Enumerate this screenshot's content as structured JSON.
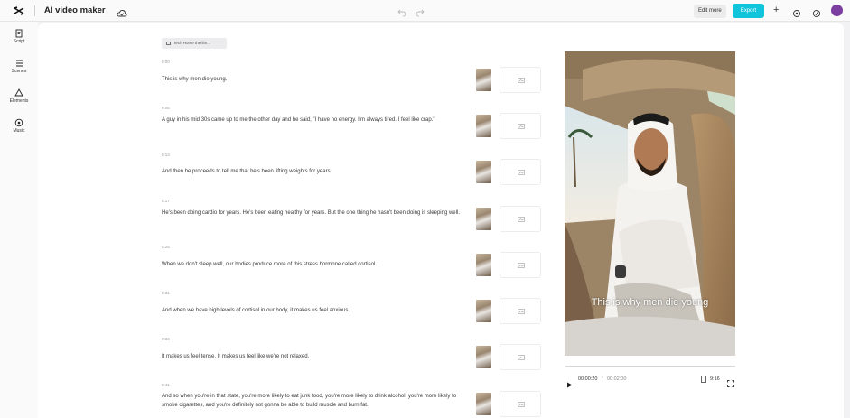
{
  "header": {
    "app_title": "AI video maker",
    "edit_more_label": "Edit more",
    "export_label": "Export",
    "add_label": "+"
  },
  "sidebar": {
    "items": [
      {
        "label": "Script",
        "icon": "script-icon"
      },
      {
        "label": "Scenes",
        "icon": "scenes-icon"
      },
      {
        "label": "Elements",
        "icon": "elements-icon"
      },
      {
        "label": "Music",
        "icon": "music-icon"
      }
    ]
  },
  "script": {
    "chip_label": "Tech Home the lim...",
    "scenes": [
      {
        "time": "0:00",
        "text": "This is why men die young."
      },
      {
        "time": "0:05",
        "text": "A guy in his mid 30s came up to me the other day and he said, \"I have no energy. I'm always tired. I feel like crap.\""
      },
      {
        "time": "0:13",
        "text": "And then he proceeds to tell me that he's been lifting weights for years."
      },
      {
        "time": "0:17",
        "text": "He's been doing cardio for years. He's been eating healthy for years. But the one thing he hasn't been doing is sleeping well."
      },
      {
        "time": "0:25",
        "text": "When we don't sleep well, our bodies produce more of this stress hormone called cortisol."
      },
      {
        "time": "0:31",
        "text": "And when we have high levels of cortisol in our body, it makes us feel anxious."
      },
      {
        "time": "0:34",
        "text": "It makes us feel tense. It makes us feel like we're not relaxed."
      },
      {
        "time": "0:41",
        "text": "And so when you're in that state, you're more likely to eat junk food, you're more likely to drink alcohol, you're more likely to smoke cigarettes, and you're definitely not gonna be able to build muscle and burn fat."
      }
    ]
  },
  "preview": {
    "caption": "This is why men die young",
    "progress": 0.0,
    "current_time": "00:00:20",
    "separator": "/",
    "total_time": "00:02:00",
    "aspect_ratio": "9:16"
  },
  "colors": {
    "accent": "#10c4dc",
    "avatar": "#7b3fa0"
  }
}
